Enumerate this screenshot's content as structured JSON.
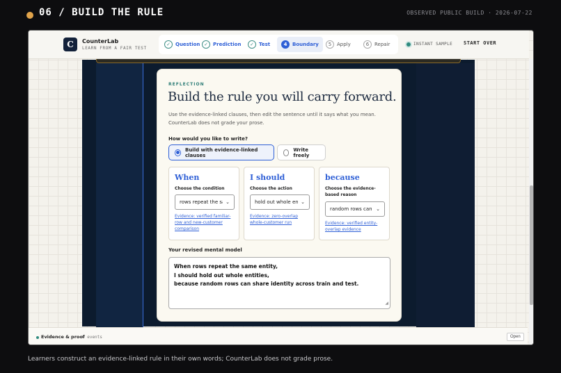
{
  "header": {
    "step_title": "06 / BUILD THE RULE",
    "build_info": "OBSERVED PUBLIC BUILD · 2026-07-22"
  },
  "app": {
    "logo_letter": "C",
    "brand_name": "CounterLab",
    "brand_tagline": "LEARN FROM A FAIR TEST",
    "steps": [
      {
        "marker": "✓",
        "label": "Question",
        "state": "done"
      },
      {
        "marker": "✓",
        "label": "Prediction",
        "state": "done"
      },
      {
        "marker": "✓",
        "label": "Test",
        "state": "done"
      },
      {
        "marker": "4",
        "label": "Boundary",
        "state": "active"
      },
      {
        "marker": "5",
        "label": "Apply",
        "state": "future"
      },
      {
        "marker": "6",
        "label": "Repair",
        "state": "future"
      }
    ],
    "instant_sample": "INSTANT SAMPLE",
    "start_over": "START OVER"
  },
  "card": {
    "eyebrow": "REFLECTION",
    "title": "Build the rule you will carry forward.",
    "description": "Use the evidence-linked clauses, then edit the sentence until it says what you mean. CounterLab does not grade your prose.",
    "question": "How would you like to write?",
    "options": [
      {
        "label": "Build with evidence-linked clauses",
        "selected": true
      },
      {
        "label": "Write freely",
        "selected": false
      }
    ],
    "clauses": [
      {
        "head": "When",
        "sub": "Choose the condition",
        "value": "rows repeat the same entity",
        "evidence": "Evidence: verified familiar-row and new-customer comparison"
      },
      {
        "head": "I should",
        "sub": "Choose the action",
        "value": "hold out whole entities",
        "evidence": "Evidence: zero-overlap whole-customer run"
      },
      {
        "head": "because",
        "sub": "Choose the evidence-based reason",
        "value": "random rows can share identity",
        "evidence": "Evidence: verified entity-overlap evidence"
      }
    ],
    "model_label": "Your revised mental model",
    "model_lines": [
      "When rows repeat the same entity,",
      "I should hold out whole entities,",
      "because random rows can share identity across train and test."
    ]
  },
  "footer": {
    "label": "Evidence & proof",
    "count": "0 events",
    "open": "Open"
  },
  "caption": "Learners construct an evidence-linked rule in their own words; CounterLab does not grade prose.",
  "colors": {
    "accent": "#2e5fd6",
    "teal": "#2e7d77",
    "navy": "#0c1b2e",
    "step_dot": "#e0a34a"
  }
}
